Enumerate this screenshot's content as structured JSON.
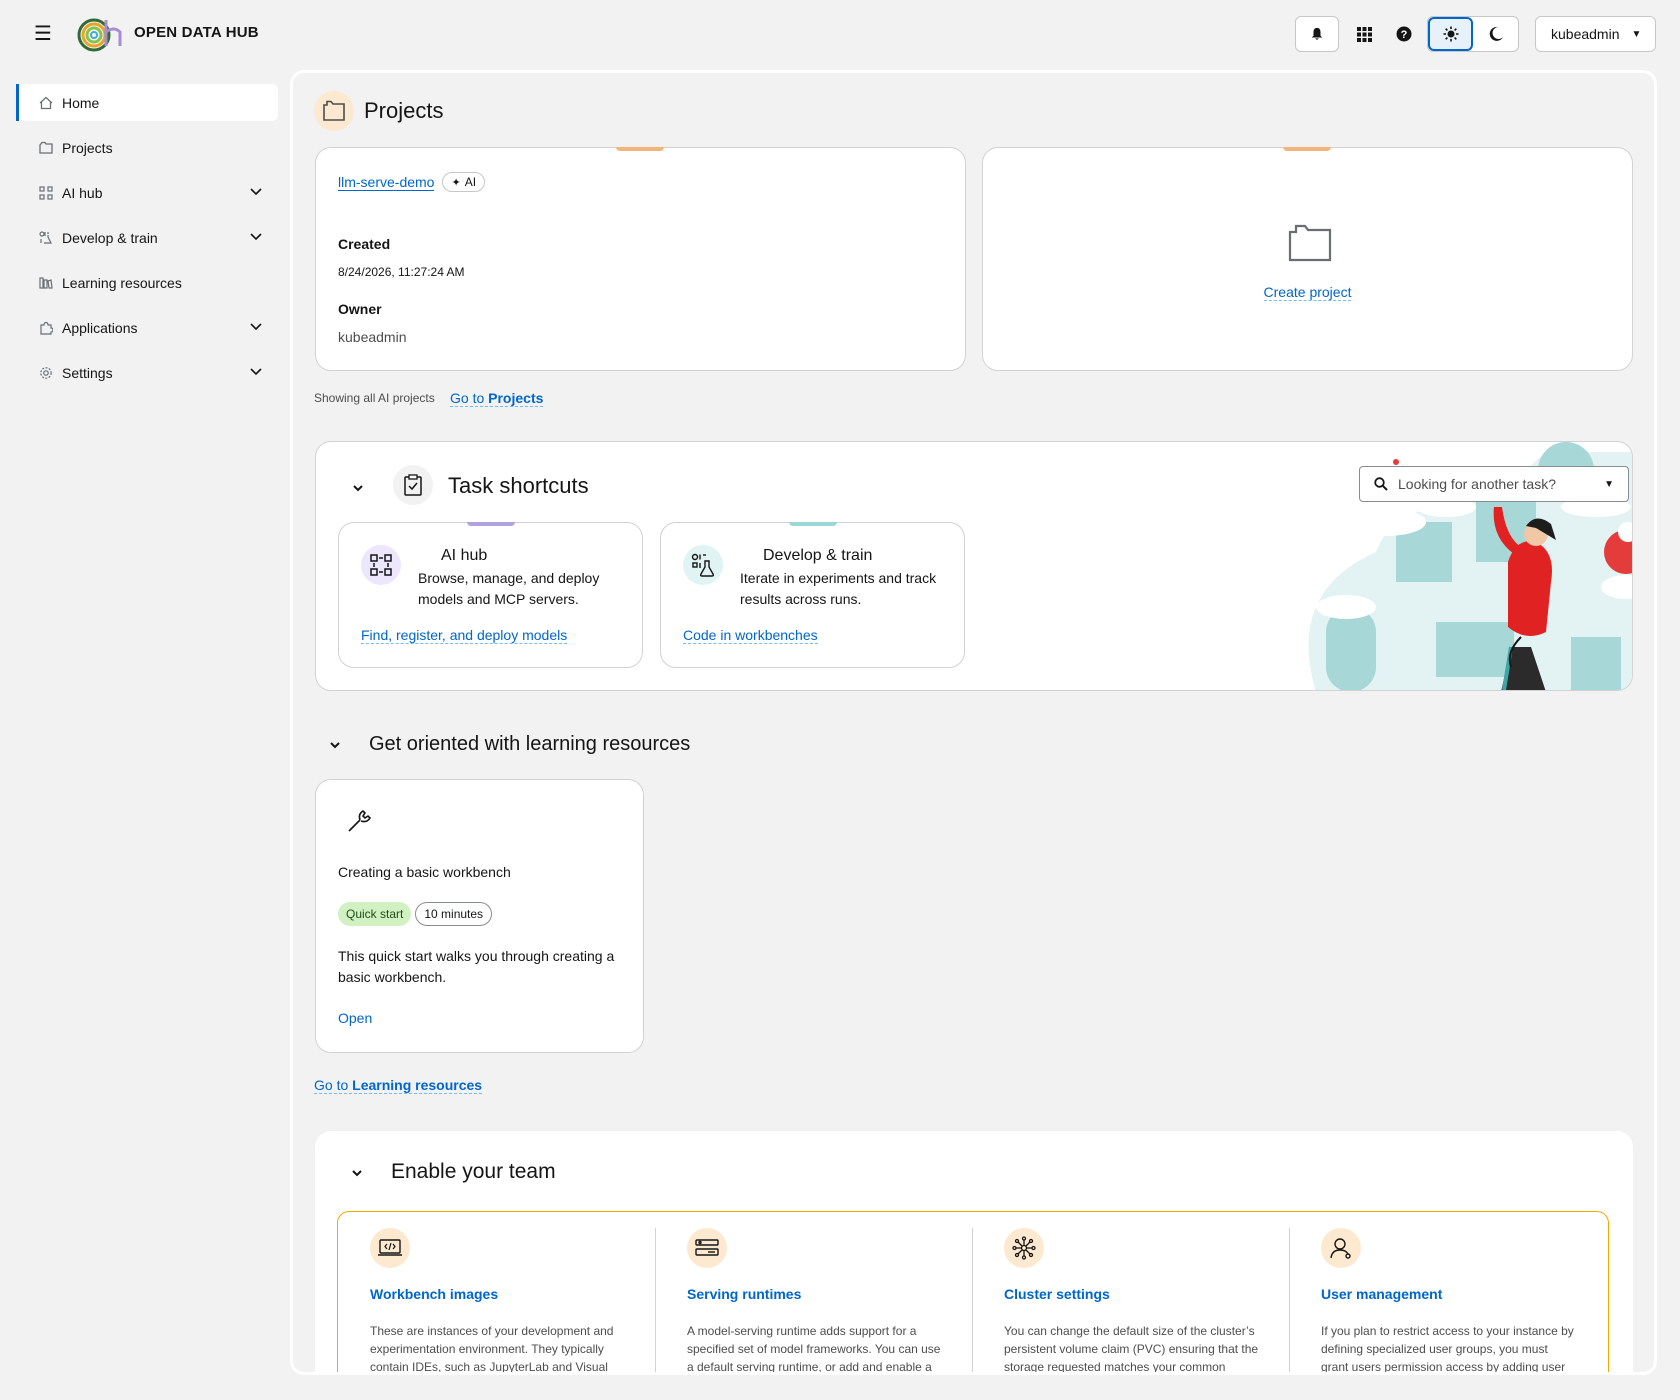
{
  "header": {
    "brand_bold": "OPEN",
    "brand_rest": " DATA HUB",
    "user": "kubeadmin"
  },
  "sidebar": {
    "items": [
      {
        "label": "Home",
        "icon": "home-icon"
      },
      {
        "label": "Projects",
        "icon": "folder-icon"
      },
      {
        "label": "AI hub",
        "icon": "ai-hub-icon"
      },
      {
        "label": "Develop & train",
        "icon": "develop-icon"
      },
      {
        "label": "Learning resources",
        "icon": "learning-icon"
      },
      {
        "label": "Applications",
        "icon": "puzzle-icon"
      },
      {
        "label": "Settings",
        "icon": "gear-icon"
      }
    ]
  },
  "projects": {
    "title": "Projects",
    "card": {
      "name": "llm-serve-demo",
      "badge": "AI",
      "created_label": "Created",
      "created_value": "8/24/2026, 11:27:24 AM",
      "owner_label": "Owner",
      "owner_value": "kubeadmin"
    },
    "create_label": "Create project",
    "showing_text": "Showing all AI projects",
    "goto_prefix": "Go to ",
    "goto_link": "Projects"
  },
  "tasks": {
    "title": "Task shortcuts",
    "search_placeholder": "Looking for another task?",
    "cards": [
      {
        "title": "AI hub",
        "desc": "Browse, manage, and deploy models and MCP servers.",
        "link": "Find, register, and deploy models"
      },
      {
        "title": "Develop & train",
        "desc": "Iterate in experiments and track results across runs.",
        "link": "Code in workbenches"
      }
    ]
  },
  "learning": {
    "title": "Get oriented with learning resources",
    "card": {
      "title": "Creating a basic workbench",
      "tag_type": "Quick start",
      "tag_time": "10 minutes",
      "desc": "This quick start walks you through creating a basic workbench.",
      "action": "Open"
    },
    "goto_prefix": "Go to ",
    "goto_link": "Learning resources"
  },
  "team": {
    "title": "Enable your team",
    "items": [
      {
        "title": "Workbench images",
        "desc": "These are instances of your development and experimentation environment. They typically contain IDEs, such as JupyterLab and Visual"
      },
      {
        "title": "Serving runtimes",
        "desc": "A model-serving runtime adds support for a specified set of model frameworks. You can use a default serving runtime, or add and enable a"
      },
      {
        "title": "Cluster settings",
        "desc": "You can change the default size of the cluster’s persistent volume claim (PVC) ensuring that the storage requested matches your common"
      },
      {
        "title": "User management",
        "desc": "If you plan to restrict access to your instance by defining specialized user groups, you must grant users permission access by adding user"
      }
    ]
  }
}
